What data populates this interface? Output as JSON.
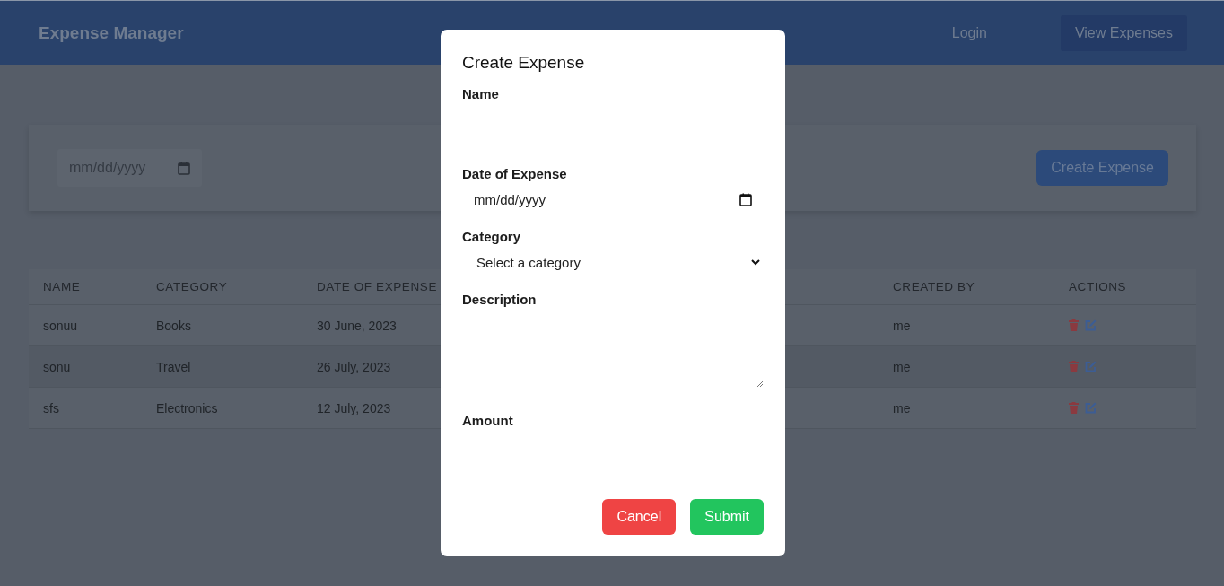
{
  "navbar": {
    "brand": "Expense Manager",
    "links": [
      {
        "label": "Login",
        "kind": "link"
      },
      {
        "label": "View Expenses",
        "kind": "button"
      }
    ]
  },
  "filter_bar": {
    "date_placeholder": "mm/dd/yyyy",
    "create_button": "Create Expense"
  },
  "table": {
    "columns": [
      "NAME",
      "CATEGORY",
      "DATE OF EXPENSE",
      "",
      "CREATED BY",
      "ACTIONS"
    ],
    "rows": [
      {
        "name": "sonuu",
        "category": "Books",
        "date": "30 June, 2023",
        "created_by": "me"
      },
      {
        "name": "sonu",
        "category": "Travel",
        "date": "26 July, 2023",
        "created_by": "me"
      },
      {
        "name": "sfs",
        "category": "Electronics",
        "date": "12 July, 2023",
        "created_by": "me"
      }
    ]
  },
  "modal": {
    "title": "Create Expense",
    "fields": [
      {
        "label": "Name",
        "kind": "text"
      },
      {
        "label": "Date of Expense",
        "kind": "date",
        "placeholder": "mm/dd/yyyy"
      },
      {
        "label": "Category",
        "kind": "select",
        "value": "Select a category"
      },
      {
        "label": "Description",
        "kind": "textarea"
      },
      {
        "label": "Amount",
        "kind": "text"
      }
    ],
    "buttons": [
      {
        "label": "Cancel",
        "kind": "cancel"
      },
      {
        "label": "Submit",
        "kind": "submit"
      }
    ]
  }
}
